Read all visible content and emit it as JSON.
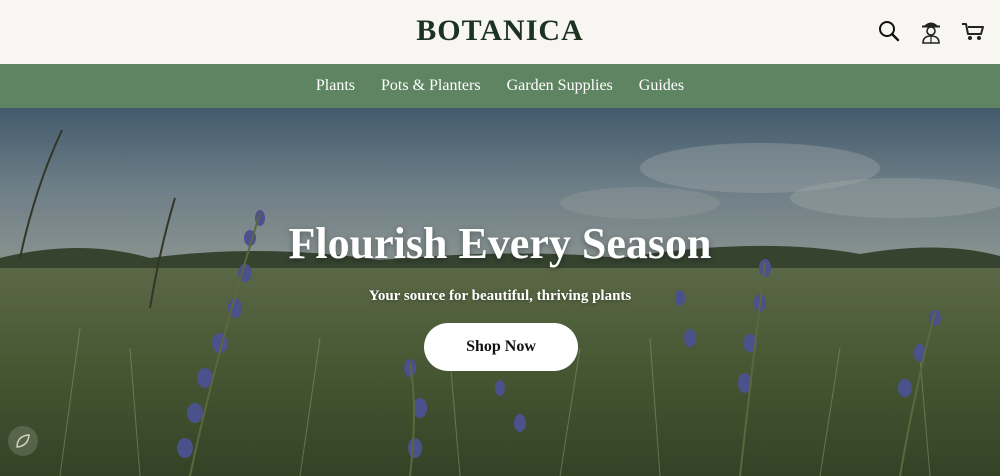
{
  "brand": {
    "name": "BOTANICA"
  },
  "header": {
    "icons": [
      "search-icon",
      "account-icon",
      "cart-icon"
    ]
  },
  "nav": {
    "items": [
      {
        "label": "Plants"
      },
      {
        "label": "Pots & Planters"
      },
      {
        "label": "Garden Supplies"
      },
      {
        "label": "Guides"
      }
    ]
  },
  "hero": {
    "title": "Flourish Every Season",
    "subtitle": "Your source for beautiful, thriving plants",
    "cta_label": "Shop Now"
  },
  "colors": {
    "nav_bg": "#5f8462",
    "brand_text": "#1d3321",
    "header_bg": "#f7f6f2"
  }
}
